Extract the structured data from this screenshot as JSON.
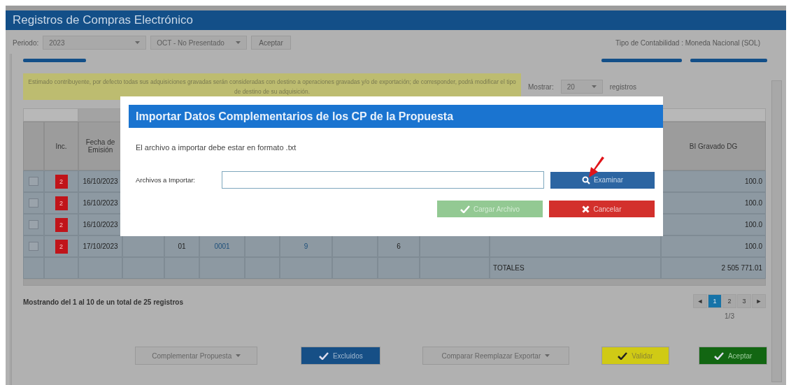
{
  "window": {
    "title": "Registros de Compras Electrónico"
  },
  "toolbar": {
    "period_label": "Periodo:",
    "year": "2023",
    "month": "OCT - No Presentado",
    "accept": "Aceptar",
    "accounting_type": "Tipo de Contabilidad : Moneda Nacional (SOL)"
  },
  "notice": "Estimado contribuyente, por defecto todas sus adquisiciones gravadas serán consideradas con destino a operaciones gravadas y/o de exportación; de corresponder, podrá modificar el tipo de destino de su adquisición.",
  "page_size": {
    "label": "Mostrar:",
    "value": "20",
    "suffix": "registros"
  },
  "table": {
    "columns": {
      "column_2": "Inc.",
      "column_3": "Fecha de Emisión",
      "column_13": "BI Gravado DG"
    },
    "rows": [
      {
        "checked": false,
        "inc": "2",
        "date": "16/10/2023",
        "amount": "100.0"
      },
      {
        "checked": false,
        "inc": "2",
        "date": "16/10/2023",
        "amount": "100.0"
      },
      {
        "checked": false,
        "inc": "2",
        "date": "16/10/2023",
        "amount": "100.0"
      },
      {
        "checked": false,
        "inc": "2",
        "date": "17/10/2023",
        "column_5": "01",
        "column_6": "0001",
        "column_8": "9",
        "column_10": "6",
        "amount": "100.0"
      }
    ],
    "totals": {
      "label": "TOTALES",
      "value": "2 505 771.01"
    }
  },
  "summary": "Mostrando del 1 al 10 de un total de 25 registros",
  "pagination": {
    "prev": "◄",
    "next": "►",
    "pages": [
      {
        "label": "1",
        "selected": true
      },
      {
        "label": "2",
        "selected": false
      },
      {
        "label": "3",
        "selected": false
      }
    ],
    "position": "1/3"
  },
  "actions": [
    {
      "kind": "dropdown",
      "label": "Complementar Propuesta"
    },
    {
      "kind": "primary",
      "label": "Excluidos"
    },
    {
      "kind": "dropdown",
      "label": "Comparar Reemplazar Exportar"
    },
    {
      "kind": "warning",
      "label": "Validar"
    },
    {
      "kind": "success",
      "label": "Aceptar"
    }
  ],
  "modal": {
    "title": "Importar Datos Complementarios de los CP de la Propuesta",
    "message": "El archivo a importar debe estar en formato .txt",
    "file_label": "Archivos a Importar:",
    "browse": "Examinar",
    "load": {
      "label": "Cargar Archivo",
      "disabled": true
    },
    "cancel": "Cancelar"
  }
}
